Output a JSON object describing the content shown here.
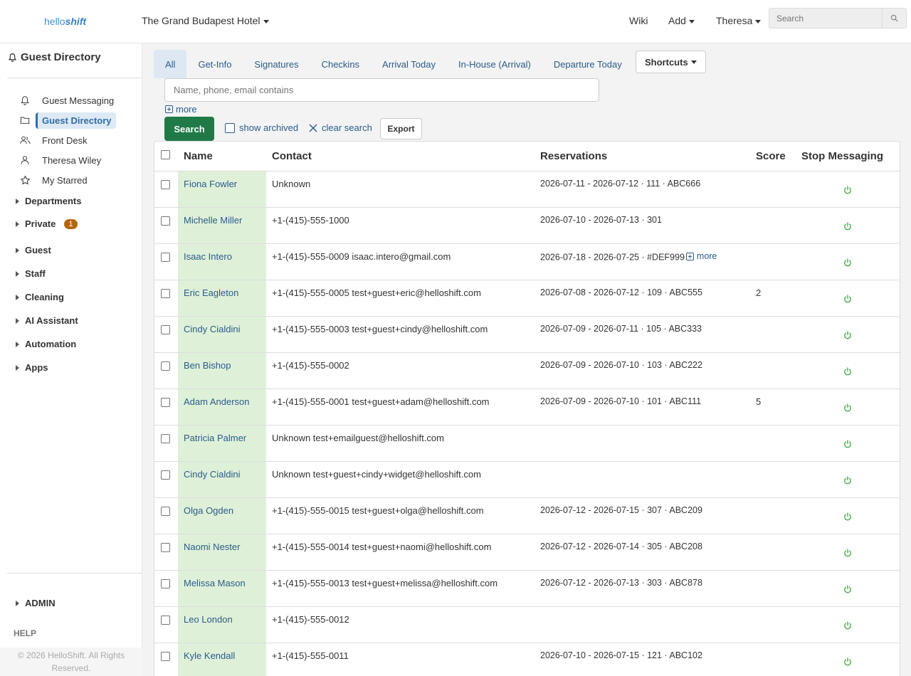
{
  "header": {
    "logo_hello": "hello",
    "logo_shift": "shift",
    "hotel": "The Grand Budapest Hotel",
    "wiki": "Wiki",
    "add": "Add",
    "user": "Theresa",
    "search_placeholder": "Search"
  },
  "sidebar": {
    "title": "Guest Directory",
    "items": [
      {
        "label": "Guest Messaging",
        "icon": "bell-icon"
      },
      {
        "label": "Guest Directory",
        "icon": "folder-icon",
        "active": true
      },
      {
        "label": "Front Desk",
        "icon": "users-icon"
      },
      {
        "label": "Theresa Wiley",
        "icon": "user-icon"
      },
      {
        "label": "My Starred",
        "icon": "star-icon"
      }
    ],
    "groups": [
      {
        "label": "Departments"
      },
      {
        "label": "Private",
        "badge": "1"
      },
      {
        "label": "Guest"
      },
      {
        "label": "Staff"
      },
      {
        "label": "Cleaning"
      },
      {
        "label": "AI Assistant"
      },
      {
        "label": "Automation"
      },
      {
        "label": "Apps"
      }
    ],
    "admin": "ADMIN",
    "help": "HELP",
    "copyright": "© 2026 HelloShift. All Rights Reserved."
  },
  "main": {
    "tabs": [
      "All",
      "Get-Info",
      "Signatures",
      "Checkins",
      "Arrival Today",
      "In-House (Arrival)",
      "Departure Today"
    ],
    "shortcuts": "Shortcuts",
    "search_placeholder": "Name, phone, email contains",
    "more": "more",
    "search_button": "Search",
    "show_archived": "show archived",
    "clear_search": "clear search",
    "export": "Export"
  },
  "table": {
    "headers": {
      "name": "Name",
      "contact": "Contact",
      "reservations": "Reservations",
      "score": "Score",
      "stop": "Stop Messaging"
    },
    "rows": [
      {
        "name": "Fiona Fowler",
        "contact": "Unknown",
        "res": "2026-07-11 - 2026-07-12 · 111 · ABC666",
        "score": ""
      },
      {
        "name": "Michelle Miller",
        "contact": "+1-(415)-555-1000",
        "res": "2026-07-10 - 2026-07-13 · 301",
        "score": ""
      },
      {
        "name": "Isaac Intero",
        "contact": "+1-(415)-555-0009 isaac.intero@gmail.com",
        "res": "2026-07-18 - 2026-07-25 · #DEF999",
        "res_more": "more",
        "score": ""
      },
      {
        "name": "Eric Eagleton",
        "contact": "+1-(415)-555-0005 test+guest+eric@helloshift.com",
        "res": "2026-07-08 - 2026-07-12 · 109 · ABC555",
        "score": "2"
      },
      {
        "name": "Cindy Cialdini",
        "contact": "+1-(415)-555-0003 test+guest+cindy@helloshift.com",
        "res": "2026-07-09 - 2026-07-11 · 105 · ABC333",
        "score": ""
      },
      {
        "name": "Ben Bishop",
        "contact": "+1-(415)-555-0002",
        "res": "2026-07-09 - 2026-07-10 · 103 · ABC222",
        "score": ""
      },
      {
        "name": "Adam Anderson",
        "contact": "+1-(415)-555-0001 test+guest+adam@helloshift.com",
        "res": "2026-07-09 - 2026-07-10 · 101 · ABC111",
        "score": "5"
      },
      {
        "name": "Patricia Palmer",
        "contact": "Unknown test+emailguest@helloshift.com",
        "res": "",
        "score": ""
      },
      {
        "name": "Cindy Cialdini",
        "contact": "Unknown test+guest+cindy+widget@helloshift.com",
        "res": "",
        "score": ""
      },
      {
        "name": "Olga Ogden",
        "contact": "+1-(415)-555-0015 test+guest+olga@helloshift.com",
        "res": "2026-07-12 - 2026-07-15 · 307 · ABC209",
        "score": ""
      },
      {
        "name": "Naomi Nester",
        "contact": "+1-(415)-555-0014 test+guest+naomi@helloshift.com",
        "res": "2026-07-12 - 2026-07-14 · 305 · ABC208",
        "score": ""
      },
      {
        "name": "Melissa Mason",
        "contact": "+1-(415)-555-0013 test+guest+melissa@helloshift.com",
        "res": "2026-07-12 - 2026-07-13 · 303 · ABC878",
        "score": ""
      },
      {
        "name": "Leo London",
        "contact": "+1-(415)-555-0012",
        "res": "",
        "score": ""
      },
      {
        "name": "Kyle Kendall",
        "contact": "+1-(415)-555-0011",
        "res": "2026-07-10 - 2026-07-15 · 121 · ABC102",
        "score": ""
      }
    ]
  },
  "colors": {
    "accent": "#2a5c8a",
    "search_button": "#1f7a47",
    "name_cell": "#dff0d8",
    "power": "#4caf50",
    "badge": "#b5660c"
  }
}
